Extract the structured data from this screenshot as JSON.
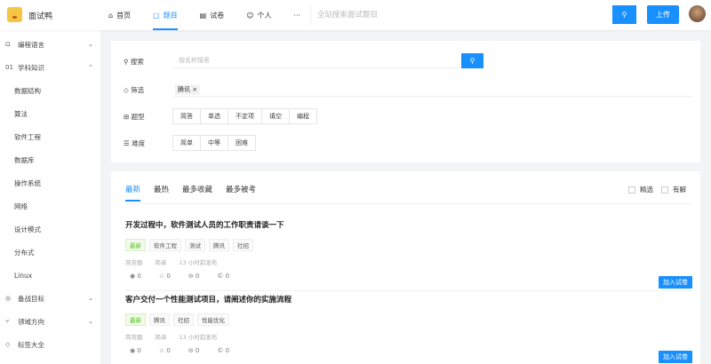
{
  "header": {
    "brand": "面试鸭",
    "nav": [
      {
        "icon": "home-icon",
        "glyph": "⌂",
        "label": "首页"
      },
      {
        "icon": "document-icon",
        "glyph": "▢",
        "label": "题目",
        "active": true
      },
      {
        "icon": "paper-icon",
        "glyph": "▤",
        "label": "试卷"
      },
      {
        "icon": "user-icon",
        "glyph": "☺",
        "label": "个人"
      },
      {
        "icon": "more-icon",
        "glyph": "",
        "label": "···"
      }
    ],
    "search_placeholder": "全站搜索面试题目",
    "search_glyph": "⚲",
    "upload": "上传"
  },
  "sidebar": {
    "items": [
      {
        "icon": "code-icon",
        "glyph": "⊡",
        "label": "编程语言",
        "chev": "⌄"
      },
      {
        "icon": "knowledge-icon",
        "glyph": "01",
        "label": "学科知识",
        "chev": "⌃"
      },
      {
        "label": "数据结构"
      },
      {
        "label": "算法"
      },
      {
        "label": "软件工程"
      },
      {
        "label": "数据库"
      },
      {
        "label": "操作系统"
      },
      {
        "label": "网络"
      },
      {
        "label": "设计模式"
      },
      {
        "label": "分布式"
      },
      {
        "label": "Linux"
      },
      {
        "icon": "target-icon",
        "glyph": "◎",
        "label": "备战目标",
        "chev": "⌄"
      },
      {
        "icon": "branch-icon",
        "glyph": "⑂",
        "label": "领域方向",
        "chev": "⌄"
      },
      {
        "icon": "tag-icon",
        "glyph": "◇",
        "label": "标签大全"
      }
    ]
  },
  "filter": {
    "search_label": "搜索",
    "search_placeholder": "按名称搜索",
    "filter_label": "筛选",
    "chip": "腾讯 ×",
    "type_label": "题型",
    "types": [
      "简答",
      "单选",
      "不定项",
      "填空",
      "编程"
    ],
    "difficulty_label": "难度",
    "difficulties": [
      "简单",
      "中等",
      "困难"
    ]
  },
  "list": {
    "tabs": [
      "最新",
      "最热",
      "最多收藏",
      "最多被考"
    ],
    "checks": [
      "精选",
      "有解"
    ],
    "add_label": "加入试卷",
    "questions": [
      {
        "title": "开发过程中，软件测试人员的工作职责请谈一下",
        "tags": [
          "最新",
          "软件工程",
          "测试",
          "腾讯",
          "社招"
        ],
        "meta": [
          "简答题",
          "简单",
          "13 小时前发布"
        ],
        "stats": [
          "0",
          "0",
          "0",
          "0"
        ]
      },
      {
        "title": "客户交付一个性能测试项目，请阐述你的实施流程",
        "tags": [
          "最新",
          "腾讯",
          "社招",
          "性能优化"
        ],
        "meta": [
          "简答题",
          "简单",
          "13 小时前发布"
        ],
        "stats": [
          "0",
          "0",
          "0",
          "0"
        ]
      }
    ]
  },
  "colors": {
    "accent": "#1890ff",
    "new_tag": "#52c41a"
  }
}
